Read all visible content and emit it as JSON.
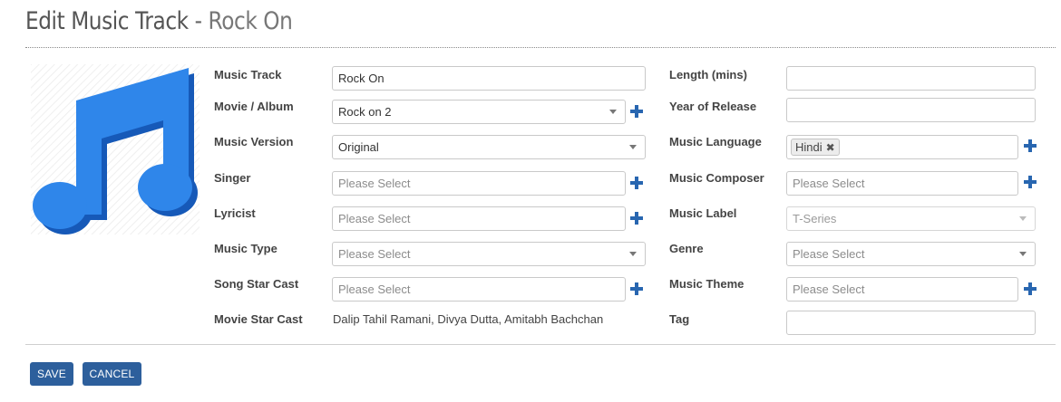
{
  "header": {
    "title": "Edit Music Track",
    "separator": " - ",
    "subtitle": "Rock On"
  },
  "album_art": {
    "icon": "music-note-icon",
    "color": "#1f7de0"
  },
  "accent_color": "#2d5f9c",
  "form": {
    "music_track": {
      "label": "Music Track",
      "value": "Rock On"
    },
    "movie_album": {
      "label": "Movie / Album",
      "value": "Rock on 2"
    },
    "music_version": {
      "label": "Music Version",
      "value": "Original"
    },
    "singer": {
      "label": "Singer",
      "placeholder": "Please Select"
    },
    "lyricist": {
      "label": "Lyricist",
      "placeholder": "Please Select"
    },
    "music_type": {
      "label": "Music Type",
      "placeholder": "Please Select"
    },
    "song_star_cast": {
      "label": "Song Star Cast",
      "placeholder": "Please Select"
    },
    "movie_star_cast": {
      "label": "Movie Star Cast",
      "value": "Dalip Tahil Ramani, Divya Dutta, Amitabh Bachchan"
    },
    "length": {
      "label": "Length (mins)",
      "value": ""
    },
    "year_of_release": {
      "label": "Year of Release",
      "value": ""
    },
    "music_language": {
      "label": "Music Language",
      "tags": [
        "Hindi"
      ],
      "remove_glyph": "✖"
    },
    "music_composer": {
      "label": "Music Composer",
      "placeholder": "Please Select"
    },
    "music_label": {
      "label": "Music Label",
      "value": "T-Series"
    },
    "genre": {
      "label": "Genre",
      "placeholder": "Please Select"
    },
    "music_theme": {
      "label": "Music Theme",
      "placeholder": "Please Select"
    },
    "tag": {
      "label": "Tag",
      "value": ""
    }
  },
  "actions": {
    "save_label": "SAVE",
    "cancel_label": "CANCEL"
  }
}
